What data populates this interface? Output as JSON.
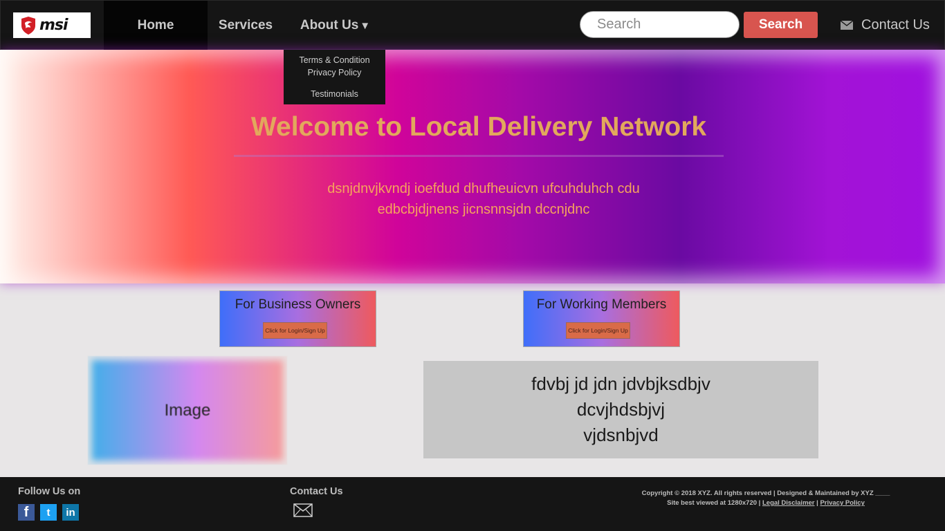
{
  "header": {
    "logo_text": "msi",
    "nav": {
      "home": "Home",
      "services": "Services",
      "about": "About Us",
      "about_caret": "▼"
    },
    "dropdown": {
      "terms": "Terms & Condition",
      "privacy": "Privacy Policy",
      "testimonials": "Testimonials"
    },
    "search": {
      "placeholder": "Search",
      "button_label": "Search"
    },
    "contact_label": "Contact Us"
  },
  "hero": {
    "title": "Welcome to Local Delivery Network",
    "text_line1": "dsnjdnvjkvndj  ioefdud dhufheuicvn ufcuhduhch cdu",
    "text_line2": "edbcbjdjnens jicnsnnsjdn dccnjdnc"
  },
  "cards": [
    {
      "title": "For Business Owners",
      "button_label": "Click for Login/Sign Up"
    },
    {
      "title": "For Working Members",
      "button_label": "Click for Login/Sign Up"
    }
  ],
  "image_box": {
    "label": "Image"
  },
  "text_box": {
    "line1": "fdvbj  jd jdn jdvbjksdbjv",
    "line2": "dcvjhdsbjvj",
    "line3": "vjdsnbjvd"
  },
  "footer": {
    "follow_title": "Follow Us on",
    "social": {
      "facebook": "f",
      "twitter": "t",
      "linkedin": "in"
    },
    "contact_title": "Contact Us",
    "copyright_line1": "Copyright © 2018 XYZ.  All rights reserved | Designed & Maintained by XYZ ____",
    "copyright_line2_prefix": "Site best viewed at 1280x720 | ",
    "legal_link": "Legal Disclaimer",
    "separator": " | ",
    "privacy_link": "Privacy Policy"
  },
  "colors": {
    "accent_button": "#d8554f",
    "hero_title": "#e2a85c",
    "hero_text": "#f5a35c",
    "nav_bg": "#151515"
  }
}
